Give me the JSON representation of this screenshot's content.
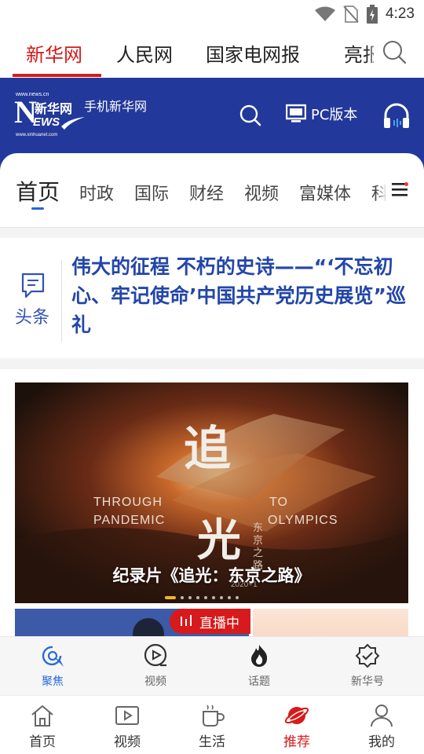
{
  "status_bar": {
    "time": "4:23"
  },
  "source_tabs": [
    {
      "label": "新华网"
    },
    {
      "label": "人民网"
    },
    {
      "label": "国家电网报"
    },
    {
      "label": "亮报"
    }
  ],
  "header": {
    "logo_url_top": "www.news.cn",
    "logo_cn": "新华网",
    "logo_n": "N",
    "logo_ews": "EWS",
    "logo_url_bottom": "www.xinhuanet.com",
    "mobile_label": "手机新华网",
    "pc_label": "PC版本"
  },
  "channels": [
    {
      "label": "首页"
    },
    {
      "label": "时政"
    },
    {
      "label": "国际"
    },
    {
      "label": "财经"
    },
    {
      "label": "视频"
    },
    {
      "label": "富媒体"
    },
    {
      "label": "科技"
    }
  ],
  "headline": {
    "tag": "头条",
    "text": "伟大的征程 不朽的史诗——“‘不忘初心、牢记使命’中国共产党历史展览”巡礼"
  },
  "banner": {
    "en_left_1": "THROUGH",
    "en_left_2": "PANDEMIC",
    "en_right_1": "TO",
    "en_right_2": "OLYMPICS",
    "calligraphy_1": "追",
    "calligraphy_2": "光",
    "vertical_text": "东京之路",
    "year": "2020+1",
    "caption": "纪录片《追光：东京之路》",
    "slide_count": 9,
    "active_slide": 0
  },
  "live_badge": {
    "label": "直播中"
  },
  "sub_nav": [
    {
      "label": "聚焦",
      "icon": "focus-icon",
      "active": true
    },
    {
      "label": "视频",
      "icon": "video-play-icon",
      "active": false
    },
    {
      "label": "话题",
      "icon": "flame-icon",
      "active": false
    },
    {
      "label": "新华号",
      "icon": "badge-check-icon",
      "active": false
    }
  ],
  "bottom_nav": [
    {
      "label": "首页",
      "icon": "home-icon",
      "active": false
    },
    {
      "label": "视频",
      "icon": "video-icon",
      "active": false
    },
    {
      "label": "生活",
      "icon": "cup-icon",
      "active": false
    },
    {
      "label": "推荐",
      "icon": "planet-icon",
      "active": true
    },
    {
      "label": "我的",
      "icon": "user-icon",
      "active": false
    }
  ],
  "colors": {
    "brand_red": "#d71a1b",
    "header_blue": "#22389a",
    "headline_blue": "#2346a8",
    "accent_blue": "#2a6ad8"
  }
}
